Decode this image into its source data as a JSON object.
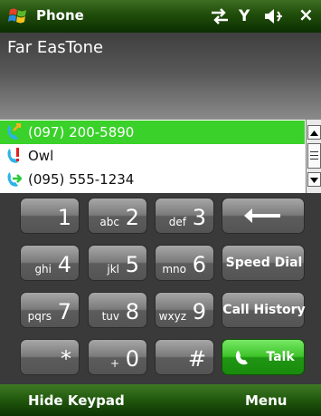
{
  "titlebar": {
    "title": "Phone",
    "icons": [
      "windows-flag-icon",
      "connectivity-icon",
      "signal-icon",
      "volume-icon",
      "close-icon"
    ],
    "close_glyph": "×",
    "signal_glyph": "Y"
  },
  "carrier": {
    "name": "Far EasTone"
  },
  "calllist": {
    "items": [
      {
        "text": "(097) 200-5890",
        "icon": "outgoing-call-icon",
        "selected": true
      },
      {
        "text": "Owl",
        "icon": "missed-call-icon",
        "selected": false
      },
      {
        "text": "(095) 555-1234",
        "icon": "incoming-call-icon",
        "selected": false
      }
    ]
  },
  "keypad": {
    "keys": [
      {
        "digit": "1",
        "letters": ""
      },
      {
        "digit": "2",
        "letters": "abc"
      },
      {
        "digit": "3",
        "letters": "def"
      },
      {
        "digit": "4",
        "letters": "ghi"
      },
      {
        "digit": "5",
        "letters": "jkl"
      },
      {
        "digit": "6",
        "letters": "mno"
      },
      {
        "digit": "7",
        "letters": "pqrs"
      },
      {
        "digit": "8",
        "letters": "tuv"
      },
      {
        "digit": "9",
        "letters": "wxyz"
      },
      {
        "digit": "*",
        "letters": ""
      },
      {
        "digit": "0",
        "letters": "+"
      },
      {
        "digit": "#",
        "letters": ""
      }
    ],
    "backspace_icon": "backspace-arrow-icon",
    "speed_dial": "Speed Dial",
    "call_history": "Call History",
    "talk": "Talk"
  },
  "softkeys": {
    "left": "Hide Keypad",
    "right": "Menu"
  },
  "colors": {
    "accent_green": "#3ad12a",
    "title_green": "#1f4d0a"
  }
}
